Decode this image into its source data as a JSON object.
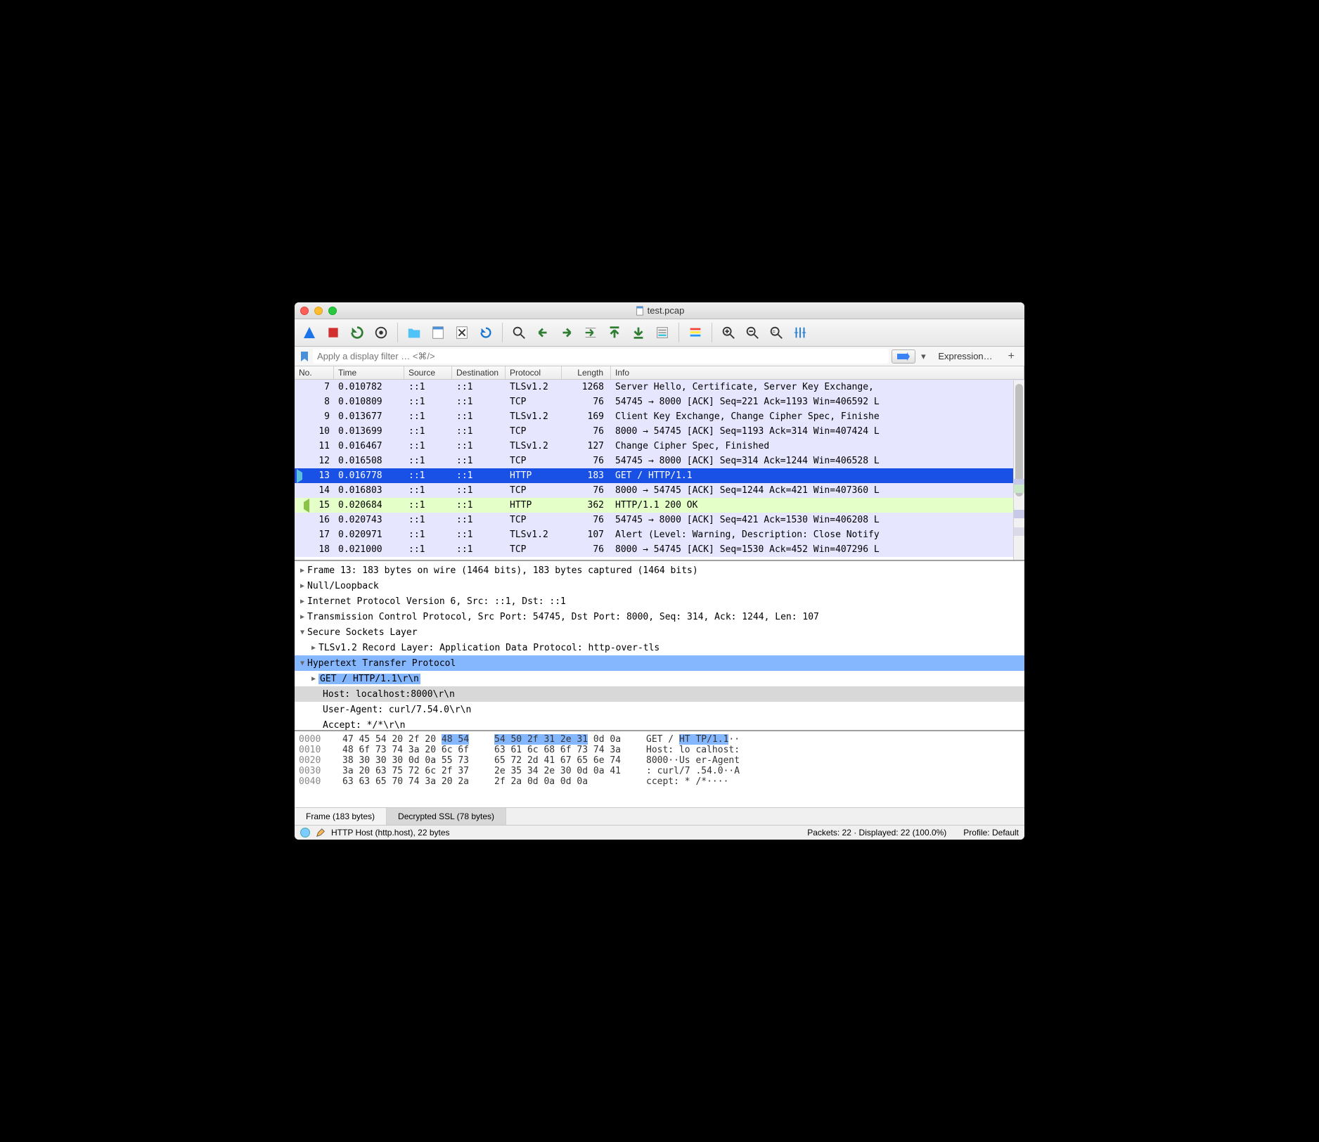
{
  "title": "test.pcap",
  "filter_placeholder": "Apply a display filter … <⌘/>",
  "filter_expression_label": "Expression…",
  "columns": {
    "no": "No.",
    "time": "Time",
    "source": "Source",
    "destination": "Destination",
    "protocol": "Protocol",
    "length": "Length",
    "info": "Info"
  },
  "packets": [
    {
      "no": 7,
      "time": "0.010782",
      "src": "::1",
      "dst": "::1",
      "proto": "TLSv1.2",
      "len": 1268,
      "info": "Server Hello, Certificate, Server Key Exchange,",
      "cls": "row-tls"
    },
    {
      "no": 8,
      "time": "0.010809",
      "src": "::1",
      "dst": "::1",
      "proto": "TCP",
      "len": 76,
      "info": "54745 → 8000 [ACK] Seq=221 Ack=1193 Win=406592 L",
      "cls": "row-tcp"
    },
    {
      "no": 9,
      "time": "0.013677",
      "src": "::1",
      "dst": "::1",
      "proto": "TLSv1.2",
      "len": 169,
      "info": "Client Key Exchange, Change Cipher Spec, Finishe",
      "cls": "row-tls"
    },
    {
      "no": 10,
      "time": "0.013699",
      "src": "::1",
      "dst": "::1",
      "proto": "TCP",
      "len": 76,
      "info": "8000 → 54745 [ACK] Seq=1193 Ack=314 Win=407424 L",
      "cls": "row-tcp"
    },
    {
      "no": 11,
      "time": "0.016467",
      "src": "::1",
      "dst": "::1",
      "proto": "TLSv1.2",
      "len": 127,
      "info": "Change Cipher Spec, Finished",
      "cls": "row-tls"
    },
    {
      "no": 12,
      "time": "0.016508",
      "src": "::1",
      "dst": "::1",
      "proto": "TCP",
      "len": 76,
      "info": "54745 → 8000 [ACK] Seq=314 Ack=1244 Win=406528 L",
      "cls": "row-tcp"
    },
    {
      "no": 13,
      "time": "0.016778",
      "src": "::1",
      "dst": "::1",
      "proto": "HTTP",
      "len": 183,
      "info": "GET / HTTP/1.1",
      "cls": "row-sel",
      "marker": "right"
    },
    {
      "no": 14,
      "time": "0.016803",
      "src": "::1",
      "dst": "::1",
      "proto": "TCP",
      "len": 76,
      "info": "8000 → 54745 [ACK] Seq=1244 Ack=421 Win=407360 L",
      "cls": "row-tcp"
    },
    {
      "no": 15,
      "time": "0.020684",
      "src": "::1",
      "dst": "::1",
      "proto": "HTTP",
      "len": 362,
      "info": "HTTP/1.1 200 OK",
      "cls": "row-http",
      "marker": "left"
    },
    {
      "no": 16,
      "time": "0.020743",
      "src": "::1",
      "dst": "::1",
      "proto": "TCP",
      "len": 76,
      "info": "54745 → 8000 [ACK] Seq=421 Ack=1530 Win=406208 L",
      "cls": "row-tcp"
    },
    {
      "no": 17,
      "time": "0.020971",
      "src": "::1",
      "dst": "::1",
      "proto": "TLSv1.2",
      "len": 107,
      "info": "Alert (Level: Warning, Description: Close Notify",
      "cls": "row-tls"
    },
    {
      "no": 18,
      "time": "0.021000",
      "src": "::1",
      "dst": "::1",
      "proto": "TCP",
      "len": 76,
      "info": "8000 → 54745 [ACK] Seq=1530 Ack=452 Win=407296 L",
      "cls": "row-tcp"
    }
  ],
  "details": {
    "frame": "Frame 13: 183 bytes on wire (1464 bits), 183 bytes captured (1464 bits)",
    "null_loopback": "Null/Loopback",
    "ipv6": "Internet Protocol Version 6, Src: ::1, Dst: ::1",
    "tcp": "Transmission Control Protocol, Src Port: 54745, Dst Port: 8000, Seq: 314, Ack: 1244, Len: 107",
    "ssl": "Secure Sockets Layer",
    "ssl_record": "TLSv1.2 Record Layer: Application Data Protocol: http-over-tls",
    "http": "Hypertext Transfer Protocol",
    "http_request_line": "GET / HTTP/1.1\\r\\n",
    "http_host": "Host: localhost:8000\\r\\n",
    "http_ua": "User-Agent: curl/7.54.0\\r\\n",
    "http_accept": "Accept: */*\\r\\n"
  },
  "hex": {
    "rows": [
      {
        "off": "0000",
        "h1": "47 45 54 20 2f 20 ",
        "h1b": "48 54",
        "h2a": "54 50 2f 31 2e 31",
        "h2b": " 0d 0a",
        "asc": "GET / ",
        "ascb": "HT TP/1.1",
        "asc_tail": "··"
      },
      {
        "off": "0010",
        "h1": "48 6f 73 74 3a 20 6c 6f",
        "h1b": "",
        "h2a": "63 61 6c 68 6f 73 74 3a",
        "h2b": "",
        "asc": "Host: lo calhost:",
        "ascb": "",
        "asc_tail": ""
      },
      {
        "off": "0020",
        "h1": "38 30 30 30 0d 0a 55 73",
        "h1b": "",
        "h2a": "65 72 2d 41 67 65 6e 74",
        "h2b": "",
        "asc": "8000··Us er-Agent",
        "ascb": "",
        "asc_tail": ""
      },
      {
        "off": "0030",
        "h1": "3a 20 63 75 72 6c 2f 37",
        "h1b": "",
        "h2a": "2e 35 34 2e 30 0d 0a 41",
        "h2b": "",
        "asc": ": curl/7 .54.0··A",
        "ascb": "",
        "asc_tail": ""
      },
      {
        "off": "0040",
        "h1": "63 63 65 70 74 3a 20 2a",
        "h1b": "",
        "h2a": "2f 2a 0d 0a 0d 0a",
        "h2b": "",
        "asc": "ccept: * /*····",
        "ascb": "",
        "asc_tail": ""
      }
    ]
  },
  "tabs": {
    "frame": "Frame (183 bytes)",
    "ssl": "Decrypted SSL (78 bytes)"
  },
  "status": {
    "field": "HTTP Host (http.host), 22 bytes",
    "stats": "Packets: 22 · Displayed: 22 (100.0%)",
    "profile": "Profile: Default"
  }
}
